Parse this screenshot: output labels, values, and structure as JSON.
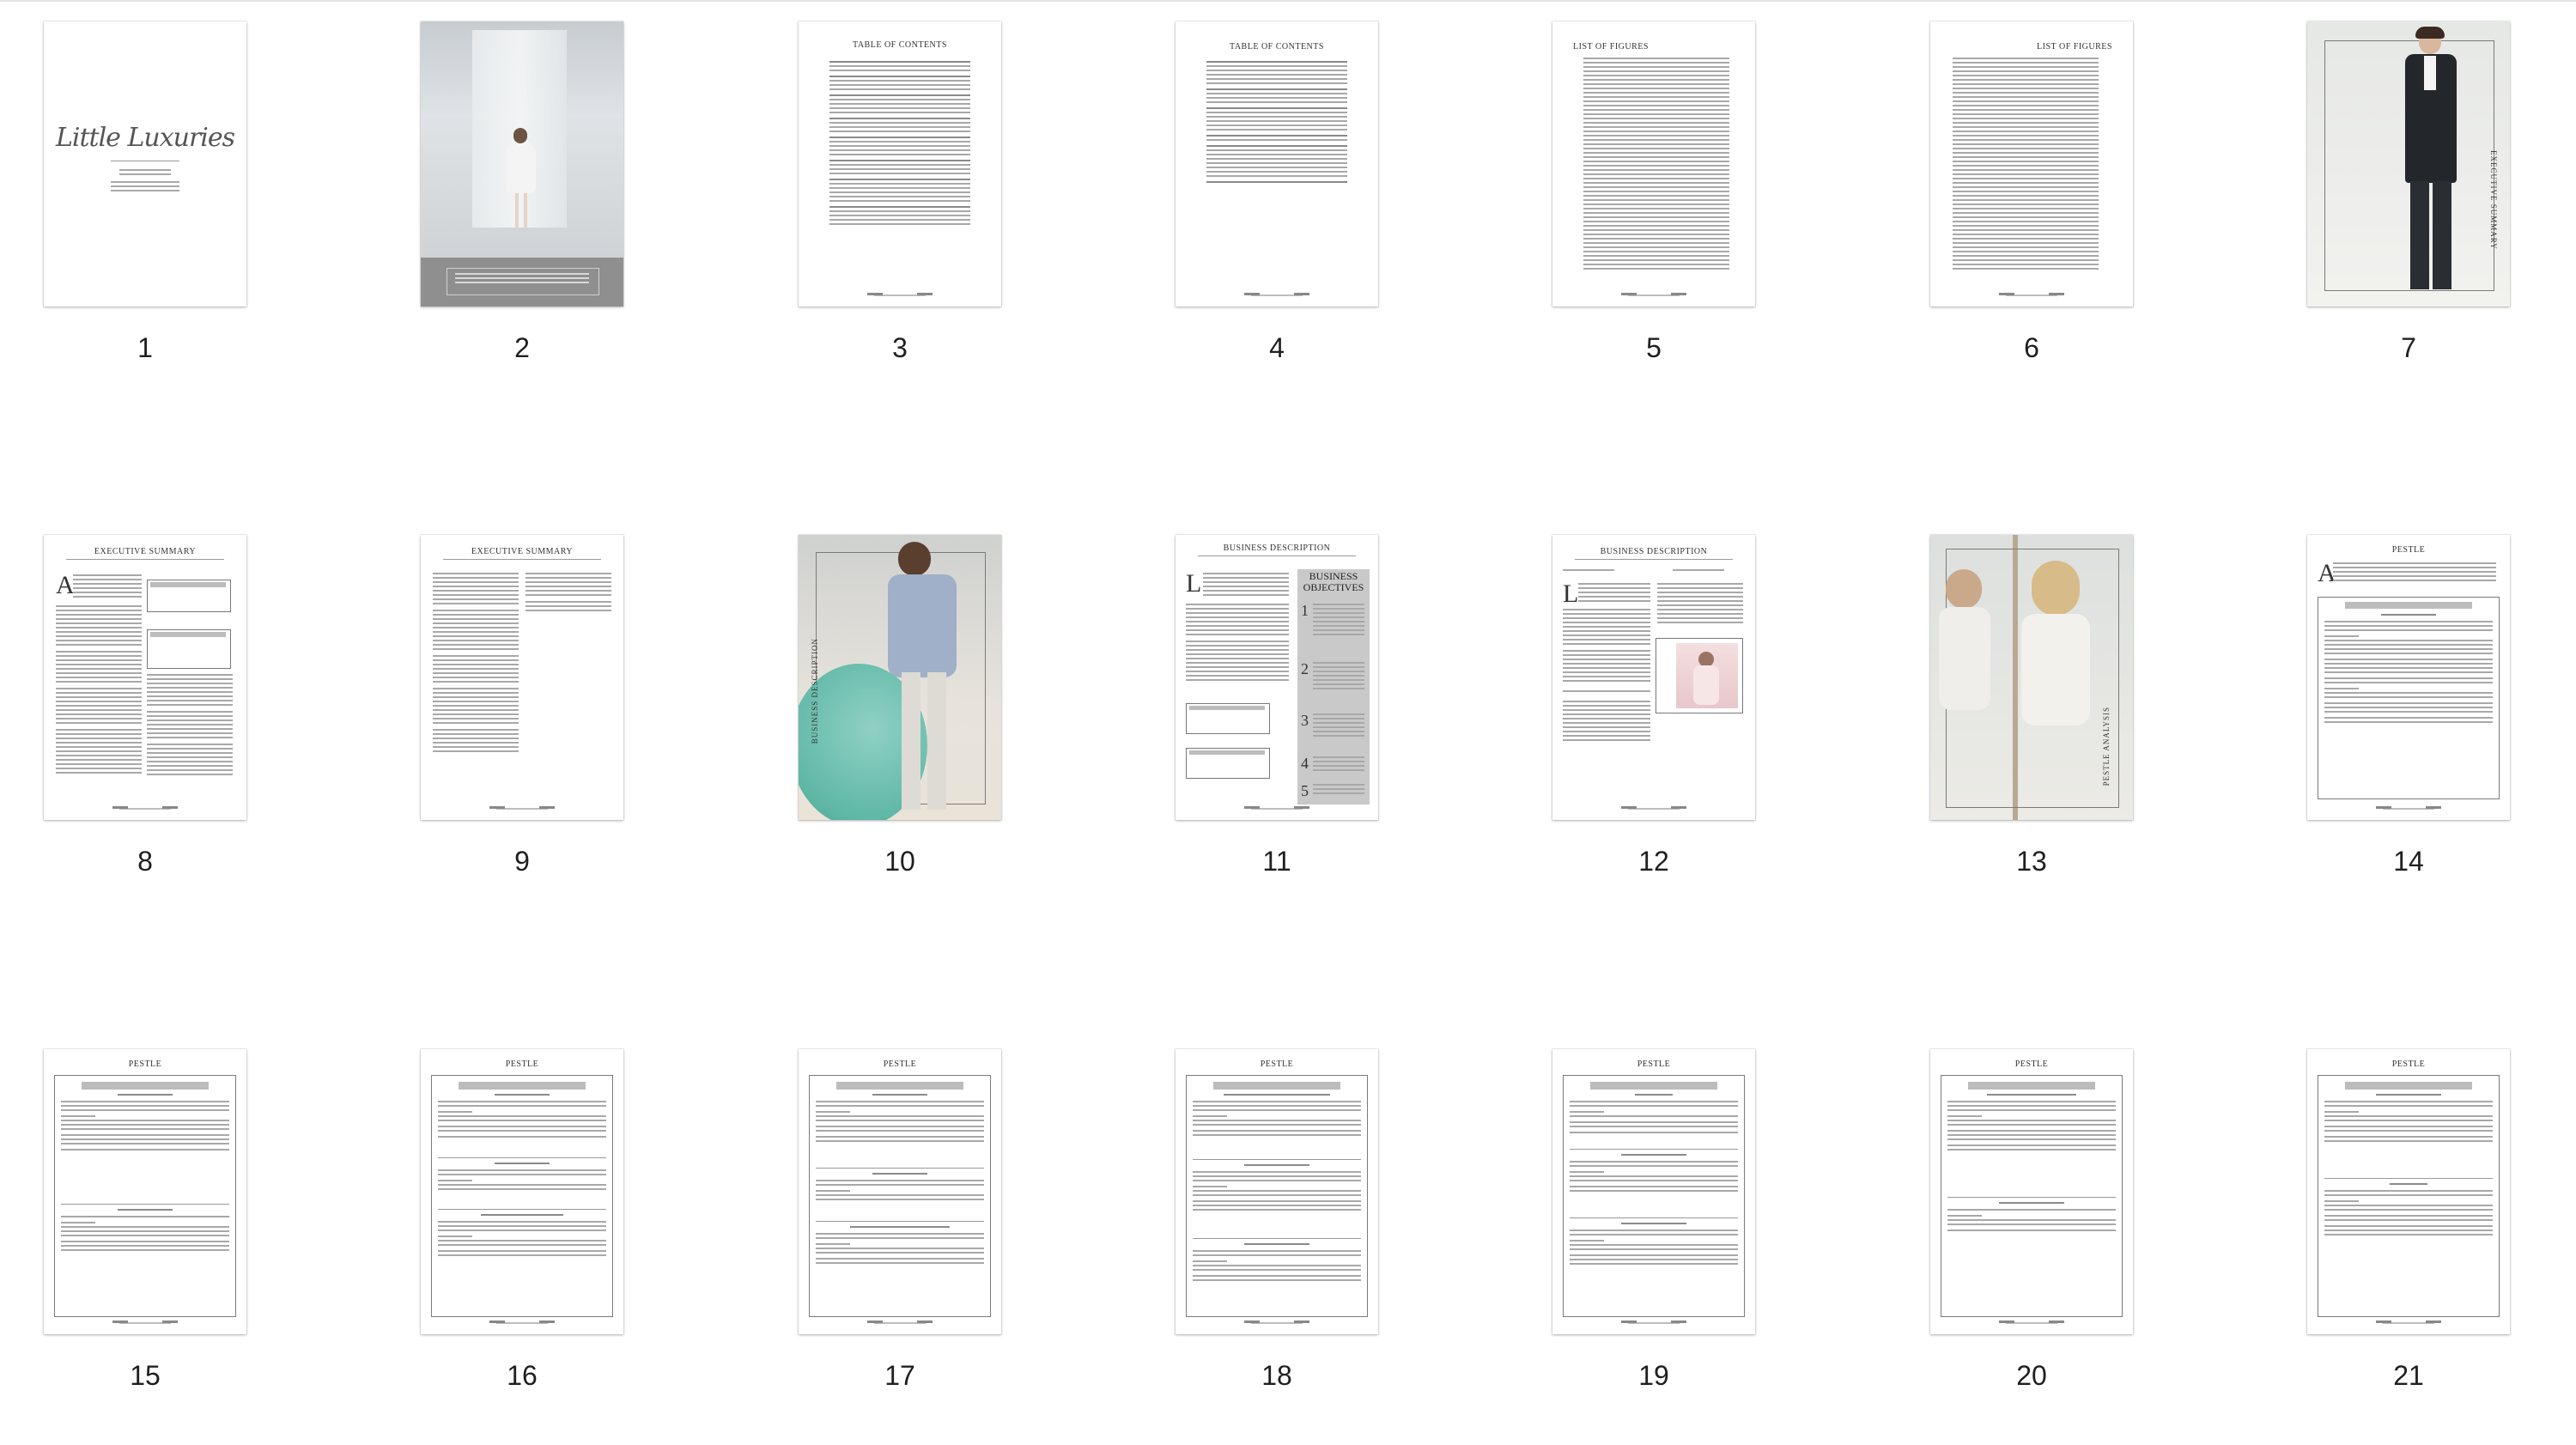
{
  "pages": [
    {
      "number": "1",
      "logo": "Little Luxuries"
    },
    {
      "number": "2"
    },
    {
      "number": "3",
      "title": "TABLE OF CONTENTS"
    },
    {
      "number": "4",
      "title": "TABLE OF CONTENTS"
    },
    {
      "number": "5",
      "title": "LIST OF FIGURES"
    },
    {
      "number": "6",
      "title": "LIST OF FIGURES"
    },
    {
      "number": "7",
      "side_label": "EXECUTIVE SUMMARY"
    },
    {
      "number": "8",
      "title": "EXECUTIVE SUMMARY"
    },
    {
      "number": "9",
      "title": "EXECUTIVE SUMMARY"
    },
    {
      "number": "10",
      "side_label": "BUSINESS DESCRIPTION"
    },
    {
      "number": "11",
      "title": "BUSINESS DESCRIPTION",
      "box_title": "BUSINESS OBJECTIVES"
    },
    {
      "number": "12",
      "title": "BUSINESS DESCRIPTION"
    },
    {
      "number": "13",
      "side_label": "PESTLE ANALYSIS"
    },
    {
      "number": "14",
      "title": "PESTLE"
    },
    {
      "number": "15",
      "title": "PESTLE"
    },
    {
      "number": "16",
      "title": "PESTLE"
    },
    {
      "number": "17",
      "title": "PESTLE"
    },
    {
      "number": "18",
      "title": "PESTLE"
    },
    {
      "number": "19",
      "title": "PESTLE"
    },
    {
      "number": "20",
      "title": "PESTLE"
    },
    {
      "number": "21",
      "title": "PESTLE"
    }
  ]
}
